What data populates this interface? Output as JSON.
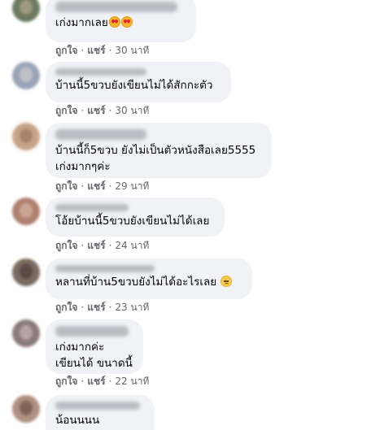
{
  "actions": {
    "like": "ถูกใจ",
    "share": "แชร์",
    "separator": "·"
  },
  "comments": [
    {
      "author": "",
      "lines": [
        "เก่งมากเลย"
      ],
      "emoji": "heart-eyes-emoji",
      "time": "30 นาที",
      "avatar_color": "#6b7a5f"
    },
    {
      "author": "",
      "lines": [
        "บ้านนี้5ขวบยังเขียนไม่ได้สักกะตัว"
      ],
      "time": "30 นาที",
      "avatar_color": "#9aa4b8"
    },
    {
      "author": "",
      "lines": [
        "บ้านนี้ก็5ขวบ ยังไม่เป็นตัวหนังสือเลย5555",
        "เก่งมากๆค่ะ"
      ],
      "time": "29 นาที",
      "avatar_color": "#c7a48a"
    },
    {
      "author": "",
      "lines": [
        "โอ้ยบ้านนี้5ขวบยังเขียนไม่ได้เลย"
      ],
      "time": "24 นาที",
      "avatar_color": "#b08070"
    },
    {
      "author": "",
      "lines": [
        "หลานที่บ้าน5ขวบยังไม่ได้อะไรเลย"
      ],
      "emoji": "sad-face-emoji",
      "time": "23 นาที",
      "avatar_color": "#7a6a60"
    },
    {
      "author": "",
      "lines": [
        "เก่งมากค่ะ",
        "เขียนได้ ขนาดนี้"
      ],
      "time": "22 นาที",
      "avatar_color": "#8a7a7a"
    },
    {
      "author": "",
      "lines": [
        "น้อนนนน"
      ],
      "avatar_color": "#b09080"
    }
  ]
}
